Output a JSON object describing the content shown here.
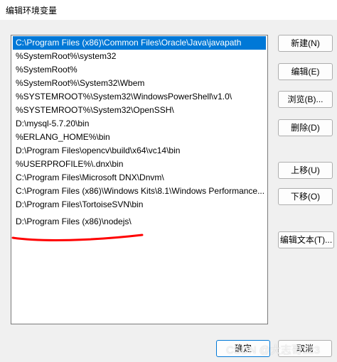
{
  "window": {
    "title": "编辑环境变量"
  },
  "list": {
    "items": [
      "C:\\Program Files (x86)\\Common Files\\Oracle\\Java\\javapath",
      "%SystemRoot%\\system32",
      "%SystemRoot%",
      "%SystemRoot%\\System32\\Wbem",
      "%SYSTEMROOT%\\System32\\WindowsPowerShell\\v1.0\\",
      "%SYSTEMROOT%\\System32\\OpenSSH\\",
      "D:\\mysql-5.7.20\\bin",
      "%ERLANG_HOME%\\bin",
      "D:\\Program Files\\opencv\\build\\x64\\vc14\\bin",
      "%USERPROFILE%\\.dnx\\bin",
      "C:\\Program Files\\Microsoft DNX\\Dnvm\\",
      "C:\\Program Files (x86)\\Windows Kits\\8.1\\Windows Performance...",
      "D:\\Program Files\\TortoiseSVN\\bin",
      "D:\\Program Files (x86)\\nodejs\\"
    ],
    "selected_index": 0
  },
  "buttons": {
    "new": "新建(N)",
    "edit": "编辑(E)",
    "browse": "浏览(B)...",
    "delete": "删除(D)",
    "move_up": "上移(U)",
    "move_down": "下移(O)",
    "edit_text": "编辑文本(T)...",
    "ok": "确定",
    "cancel": "取消"
  },
  "watermark": "CSDN @大志哥123",
  "colors": {
    "selection": "#0078d7",
    "annotation": "#ff0000"
  }
}
